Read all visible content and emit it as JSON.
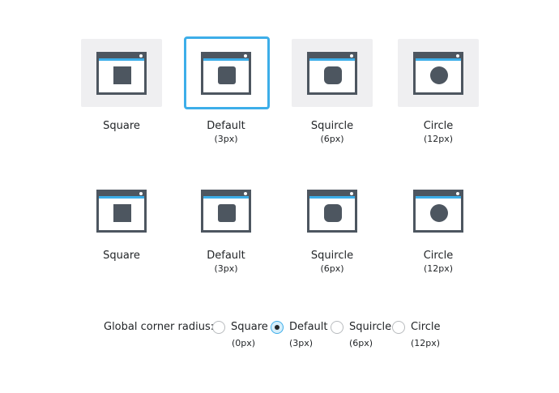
{
  "colors": {
    "accent": "#3daee9",
    "icon": "#4d5660",
    "tile_background": "#efeff1",
    "text": "#232629"
  },
  "preview_row": [
    {
      "label": "Square",
      "sub": "",
      "selected": false
    },
    {
      "label": "Default",
      "sub": "(3px)",
      "selected": true
    },
    {
      "label": "Squircle",
      "sub": "(6px)",
      "selected": false
    },
    {
      "label": "Circle",
      "sub": "(12px)",
      "selected": false
    }
  ],
  "icon_row": [
    {
      "label": "Square",
      "sub": ""
    },
    {
      "label": "Default",
      "sub": "(3px)"
    },
    {
      "label": "Squircle",
      "sub": "(6px)"
    },
    {
      "label": "Circle",
      "sub": "(12px)"
    }
  ],
  "global": {
    "label": "Global corner radius:",
    "selected": "Default",
    "options": [
      {
        "label": "Square",
        "sub": "(0px)"
      },
      {
        "label": "Default",
        "sub": "(3px)"
      },
      {
        "label": "Squircle",
        "sub": "(6px)"
      },
      {
        "label": "Circle",
        "sub": "(12px)"
      }
    ]
  }
}
